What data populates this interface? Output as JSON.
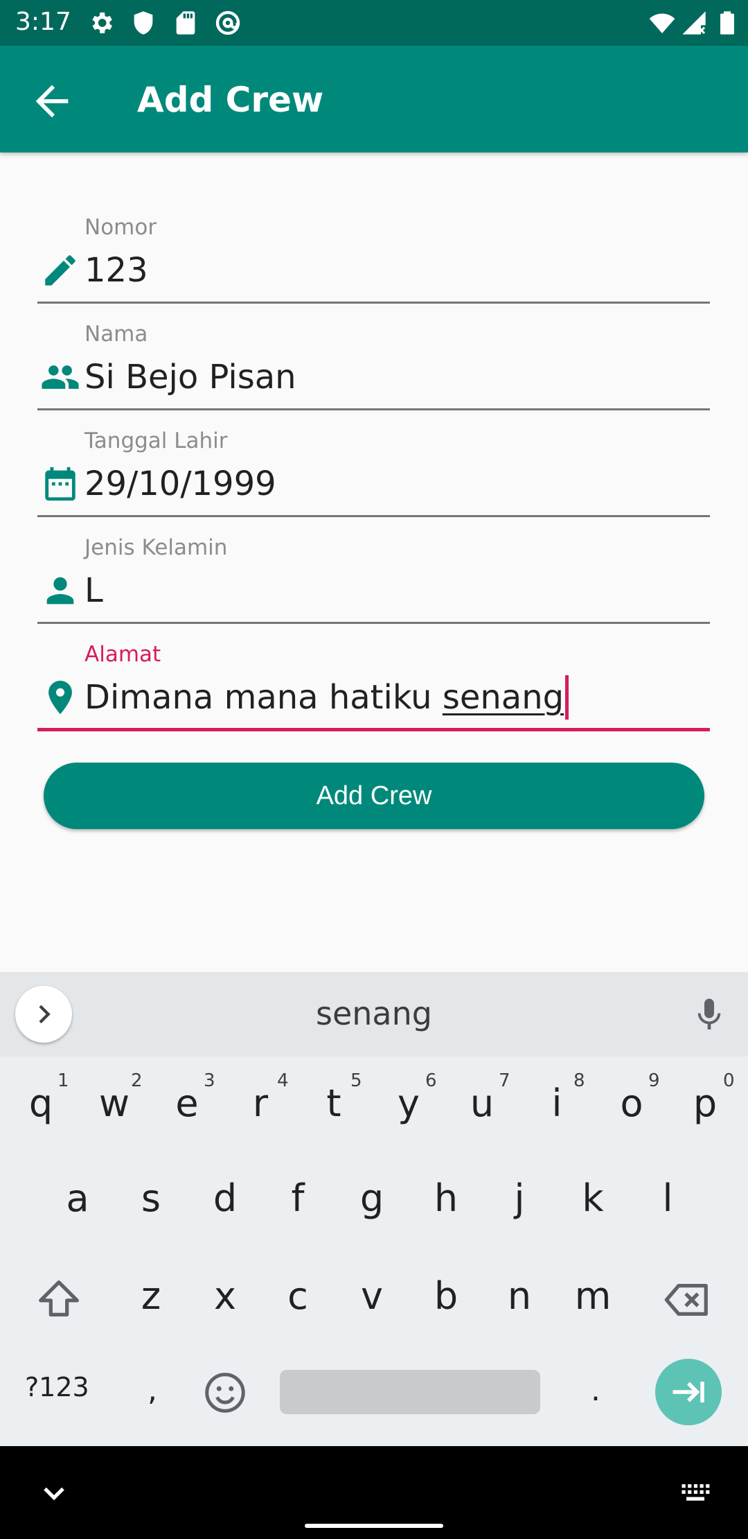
{
  "status_bar": {
    "time": "3:17",
    "icons": [
      "settings-icon",
      "shield-icon",
      "sd-card-icon",
      "at-icon",
      "wifi-icon",
      "signal-icon",
      "battery-icon"
    ]
  },
  "app_bar": {
    "title": "Add Crew",
    "back_icon": "arrow-back-icon"
  },
  "form": {
    "fields": [
      {
        "label": "Nomor",
        "value": "123",
        "icon": "pencil-icon"
      },
      {
        "label": "Nama",
        "value": "Si Bejo Pisan",
        "icon": "people-icon"
      },
      {
        "label": "Tanggal Lahir",
        "value": "29/10/1999",
        "icon": "calendar-icon"
      },
      {
        "label": "Jenis Kelamin",
        "value": "L",
        "icon": "person-icon"
      },
      {
        "label": "Alamat",
        "value_prefix": "Dimana mana hatiku ",
        "value_composing": "senang",
        "icon": "location-pin-icon",
        "focused": true
      }
    ],
    "submit_label": "Add Crew"
  },
  "keyboard": {
    "suggestion": "senang",
    "row1": [
      {
        "key": "q",
        "hint": "1"
      },
      {
        "key": "w",
        "hint": "2"
      },
      {
        "key": "e",
        "hint": "3"
      },
      {
        "key": "r",
        "hint": "4"
      },
      {
        "key": "t",
        "hint": "5"
      },
      {
        "key": "y",
        "hint": "6"
      },
      {
        "key": "u",
        "hint": "7"
      },
      {
        "key": "i",
        "hint": "8"
      },
      {
        "key": "o",
        "hint": "9"
      },
      {
        "key": "p",
        "hint": "0"
      }
    ],
    "row2": [
      "a",
      "s",
      "d",
      "f",
      "g",
      "h",
      "j",
      "k",
      "l"
    ],
    "row3": [
      "z",
      "x",
      "c",
      "v",
      "b",
      "n",
      "m"
    ],
    "symbols_label": "?123",
    "comma": ",",
    "period": "."
  },
  "colors": {
    "primary": "#00897b",
    "primary_dark": "#00695c",
    "accent": "#d81b60"
  }
}
